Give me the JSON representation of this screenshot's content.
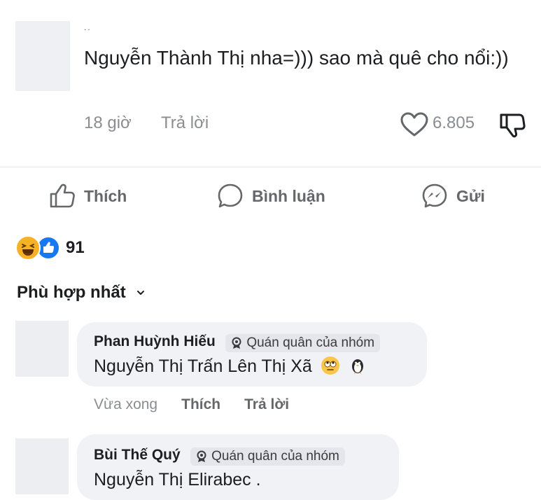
{
  "top_comment": {
    "username": "..",
    "text": "Nguyễn Thành Thị nha=))) sao mà quê cho nổi:))",
    "time": "18 giờ",
    "reply_label": "Trả lời",
    "like_count": "6.805"
  },
  "actions": {
    "like": "Thích",
    "comment": "Bình luận",
    "send": "Gửi"
  },
  "reactions": {
    "count": "91",
    "types": [
      "haha",
      "like"
    ]
  },
  "sort": {
    "label": "Phù hợp nhất"
  },
  "replies": [
    {
      "name": "Phan Huỳnh Hiếu",
      "badge": "Quán quân của nhóm",
      "text": "Nguyễn Thị Trấn Lên Thị Xã",
      "emojis": [
        "face-with-rolling-eyes",
        "penguin"
      ],
      "time": "Vừa xong",
      "like_label": "Thích",
      "reply_label": "Trả lời"
    },
    {
      "name": "Bùi Thế Quý",
      "badge": "Quán quân của nhóm",
      "text": "Nguyễn Thị Elirabec ."
    }
  ],
  "colors": {
    "text": "#1c1e21",
    "muted": "#8a8d91",
    "bubble": "#f0f2f5",
    "like_blue": "#1877f2",
    "haha_yellow": "#f7b125"
  }
}
